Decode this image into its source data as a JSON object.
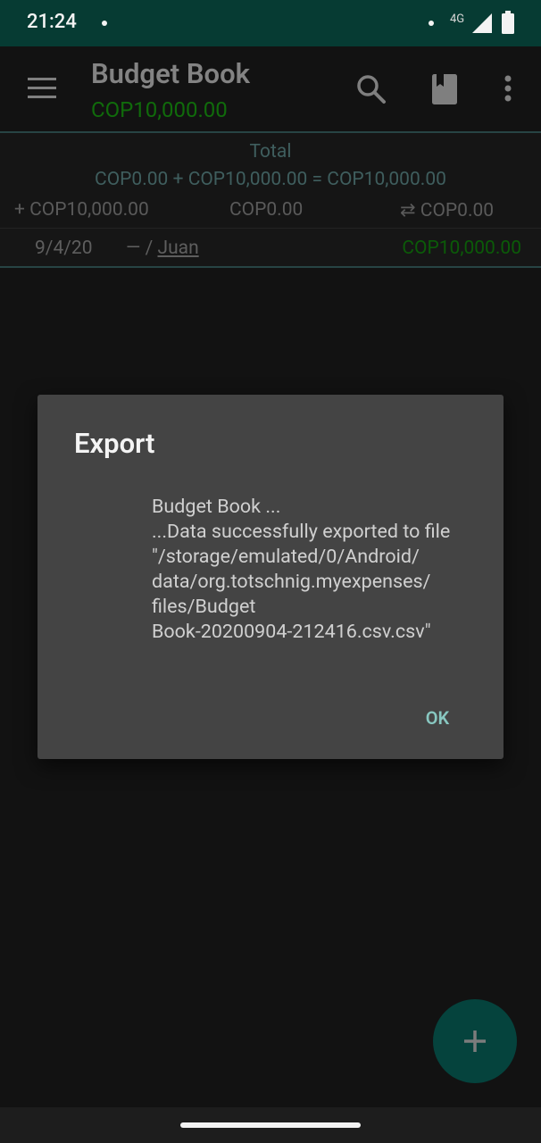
{
  "status_bar": {
    "time": "21:24",
    "network": "4G"
  },
  "app_bar": {
    "title": "Budget Book",
    "subtitle": "COP10,000.00"
  },
  "summary": {
    "total_label": "Total",
    "total_equation": "COP0.00 + COP10,000.00 = COP10,000.00",
    "income": "+ COP10,000.00",
    "expense": "COP0.00",
    "transfer": "⇄ COP0.00"
  },
  "transaction": {
    "date": "9/4/20",
    "category_prefix": "— / ",
    "payee": "Juan",
    "amount": "COP10,000.00"
  },
  "dialog": {
    "title": "Export",
    "message_lines": [
      "Budget Book ...",
      "...Data successfully exported to file",
      "\"/storage/emulated/0/Android/",
      "data/org.totschnig.myexpenses/",
      "files/Budget",
      "Book-20200904-212416.csv.csv\""
    ],
    "ok_label": "OK"
  },
  "colors": {
    "status_bar_bg": "#063b33",
    "dialog_bg": "#444444",
    "accent": "#88c7c0",
    "income_green": "#106b0b",
    "fab_bg": "#05433d"
  },
  "icons": {
    "menu": "hamburger-menu-icon",
    "search": "search-icon",
    "book": "bookmark-book-icon",
    "more": "more-vert-icon",
    "fab": "add-icon"
  }
}
